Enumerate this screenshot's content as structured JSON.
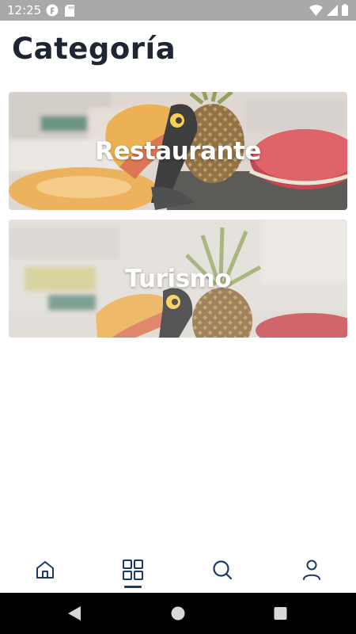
{
  "status_bar": {
    "time": "12:25"
  },
  "page": {
    "title": "Categoría"
  },
  "categories": [
    {
      "label": "Restaurante"
    },
    {
      "label": "Turismo"
    }
  ],
  "bottom_nav": {
    "items": [
      "home-icon",
      "grid-icon",
      "search-icon",
      "user-icon"
    ],
    "active_index": 1,
    "active_color": "#1a3a6a",
    "icon_color": "#1a3a6a"
  },
  "system_nav": {
    "buttons": [
      "back-icon",
      "home-circle-icon",
      "recents-icon"
    ]
  }
}
